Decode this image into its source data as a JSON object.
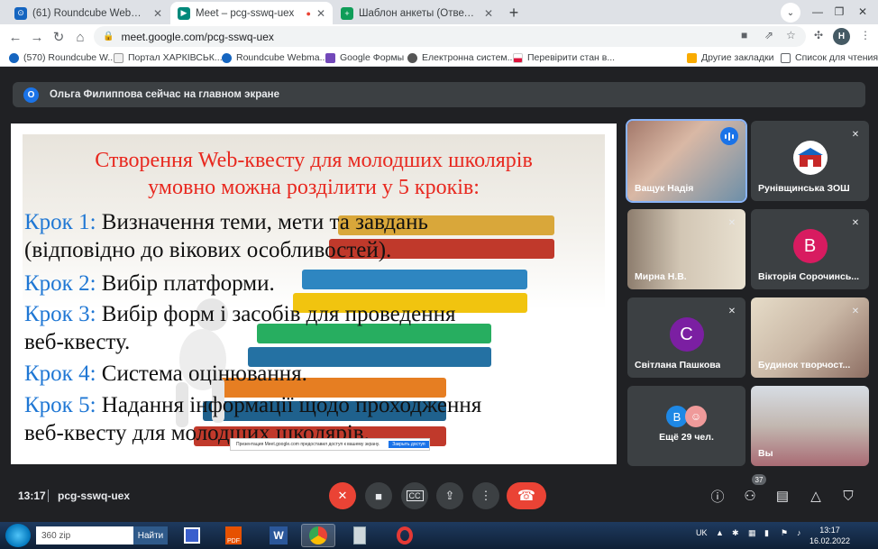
{
  "browser": {
    "tabs": [
      {
        "title": "(61) Roundcube Webmail :: Майл",
        "favicon_color": "#1565c0"
      },
      {
        "title": "Meet – pcg-sswq-uex",
        "favicon_color": "#00897b"
      },
      {
        "title": "Шаблон анкеты (Ответы) - Goo",
        "favicon_color": "#0f9d58"
      }
    ],
    "url": "meet.google.com/pcg-sswq-uex",
    "profile_letter": "H",
    "bookmarks": [
      "(570) Roundcube W...",
      "Портал ХАРКІВСЬК...",
      "Roundcube Webma...",
      "Google Формы",
      "Електронна систем...",
      "Перевірити стан в...",
      "Другие закладки",
      "Список для чтения"
    ]
  },
  "meet": {
    "banner": {
      "avatar_letter": "О",
      "text": "Ольга Филиппова сейчас на главном экране"
    },
    "slide": {
      "title_line1": "Створення Web-квесту для молодших школярів",
      "title_line2": "умовно можна розділити у 5 кроків:",
      "steps": [
        {
          "key": "Крок 1:",
          "text": " Визначення теми, мети та завдань"
        },
        {
          "key": "",
          "text": "(відповідно до вікових особливостей)."
        },
        {
          "key": "Крок 2:",
          "text": " Вибір платформи."
        },
        {
          "key": "Крок 3:",
          "text": " Вибір форм і засобів для проведення"
        },
        {
          "key": "",
          "text": "веб-квесту."
        },
        {
          "key": "Крок 4:",
          "text": " Система оцінювання."
        },
        {
          "key": "Крок 5:",
          "text": " Надання інформації щодо проходження"
        },
        {
          "key": "",
          "text": "веб-квесту для молодших школярів."
        }
      ],
      "notice_text": "Презентация Мeet.google.com предоставил доступ к вашему экрану.",
      "notice_button": "Закрыть доступ"
    },
    "participants": [
      {
        "name": "Ващук Надія",
        "type": "video",
        "speaking": true
      },
      {
        "name": "Рунівщинська ЗОШ",
        "type": "logo",
        "muted": true
      },
      {
        "name": "Мирна Н.В.",
        "type": "video",
        "muted": true
      },
      {
        "name": "Вікторія Сорочинсь...",
        "type": "letter",
        "letter": "В",
        "color": "#d81b60",
        "muted": true
      },
      {
        "name": "Світлана Пашкова",
        "type": "letter",
        "letter": "С",
        "color": "#7b1fa2",
        "muted": true
      },
      {
        "name": "Будинок творчост...",
        "type": "video",
        "muted": true
      },
      {
        "name": "Ещё 29 чел.",
        "type": "more",
        "letter": "В",
        "color": "#1e88e5"
      },
      {
        "name": "Вы",
        "type": "video"
      }
    ],
    "bottom": {
      "time": "13:17",
      "meeting_code": "pcg-sswq-uex",
      "participant_count": "37"
    }
  },
  "taskbar": {
    "search_value": "360 zip",
    "search_button": "Найти",
    "lang": "UK",
    "time": "13:17",
    "date": "16.02.2022"
  }
}
